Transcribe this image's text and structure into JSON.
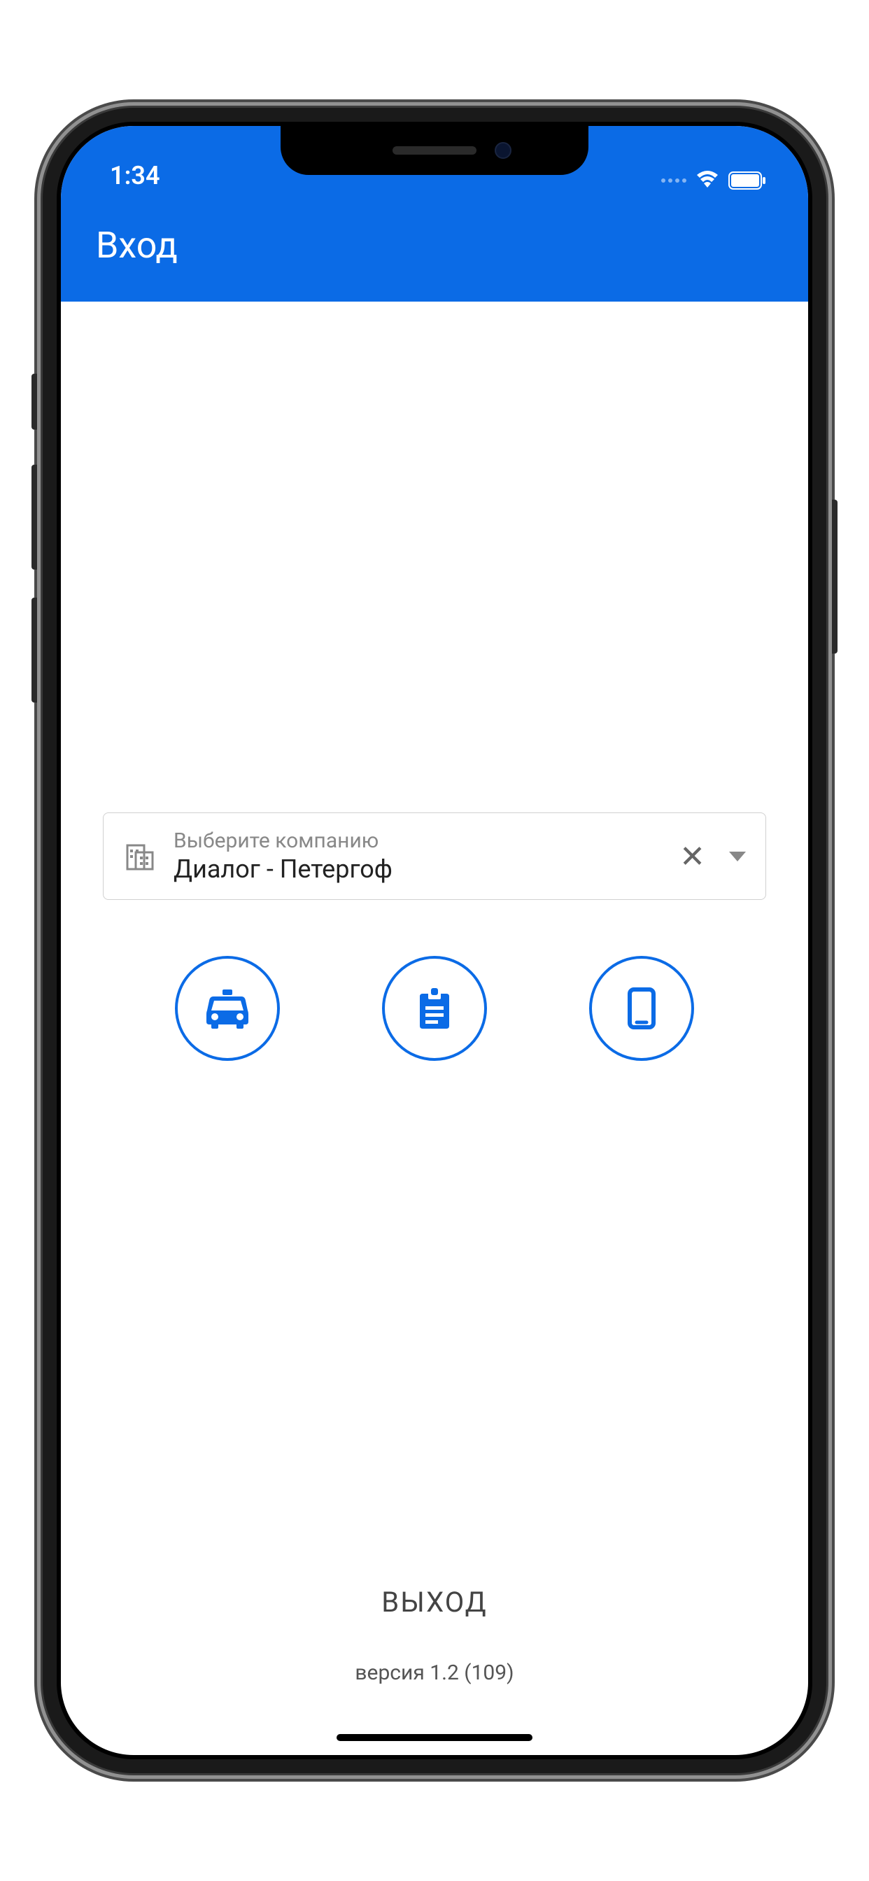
{
  "status": {
    "time": "1:34"
  },
  "header": {
    "title": "Вход"
  },
  "company": {
    "label": "Выберите компанию",
    "value": "Диалог - Петергоф"
  },
  "icons": {
    "taxi": "taxi-icon",
    "clipboard": "clipboard-icon",
    "phone": "phone-icon"
  },
  "footer": {
    "exit_label": "ВЫХОД",
    "version": "версия 1.2 (109)"
  },
  "colors": {
    "primary": "#0b6be6"
  }
}
